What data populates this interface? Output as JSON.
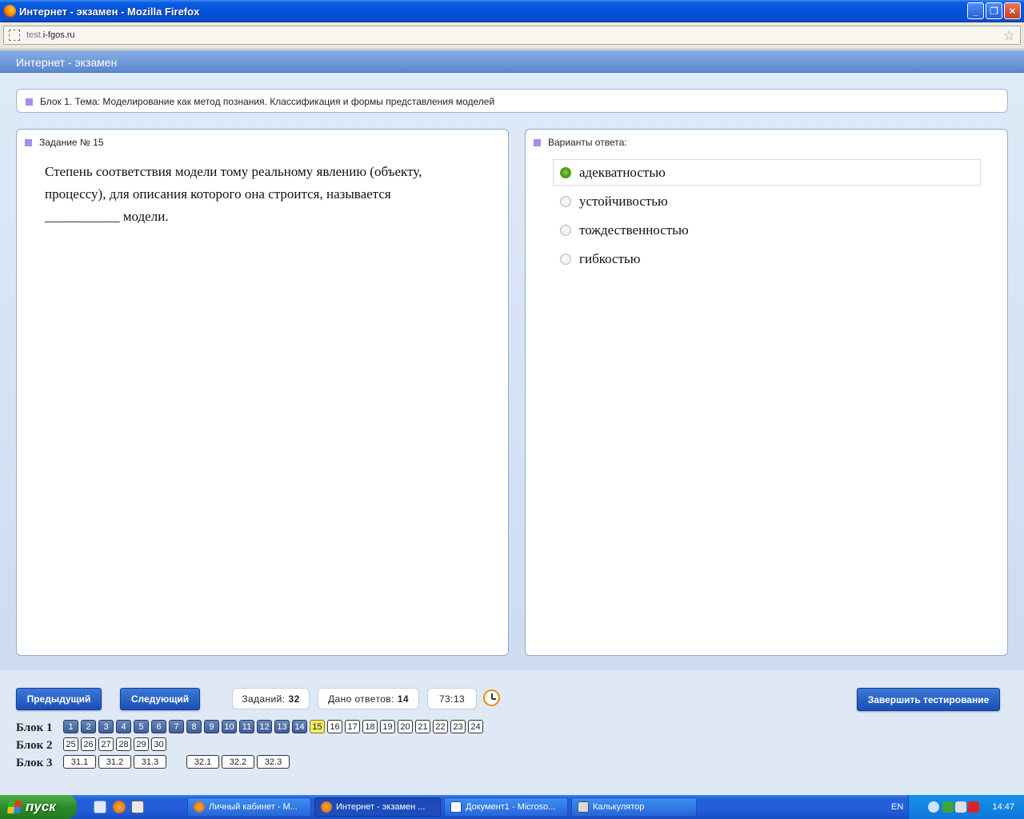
{
  "window": {
    "title": "Интернет - экзамен - Mozilla Firefox",
    "controls": [
      "_",
      "❐",
      "✕"
    ]
  },
  "browser": {
    "url_prefix": "test.",
    "url_host": "i-fgos.ru"
  },
  "app": {
    "header": "Интернет - экзамен"
  },
  "block_title": "Блок 1. Тема: Моделирование как метод познания. Классификация и формы представления моделей",
  "task": {
    "heading": "Задание № 15",
    "question_line1": "Степень соответствия модели тому реальному явлению (объекту,",
    "question_line2": "процессу), для описания которого она строится, называется",
    "question_line3": "___________ модели."
  },
  "answers": {
    "heading": "Варианты ответа:",
    "options": [
      {
        "label": "адекватностью",
        "selected": true
      },
      {
        "label": "устойчивостью",
        "selected": false
      },
      {
        "label": "тождественностью",
        "selected": false
      },
      {
        "label": "гибкостью",
        "selected": false
      }
    ]
  },
  "footer": {
    "prev_label": "Предыдущий",
    "next_label": "Следующий",
    "tasks_label": "Заданий:",
    "tasks_count": "32",
    "answered_label": "Дано ответов:",
    "answered_count": "14",
    "timer": "73:13",
    "finish_label": "Завершить тестирование"
  },
  "navigation": {
    "block1_label": "Блок 1",
    "block2_label": "Блок 2",
    "block3_label": "Блок 3",
    "block1": [
      "1",
      "2",
      "3",
      "4",
      "5",
      "6",
      "7",
      "8",
      "9",
      "10",
      "11",
      "12",
      "13",
      "14",
      "15",
      "16",
      "17",
      "18",
      "19",
      "20",
      "21",
      "22",
      "23",
      "24"
    ],
    "block2": [
      "25",
      "26",
      "27",
      "28",
      "29",
      "30"
    ],
    "block3a": [
      "31.1",
      "31.2",
      "31.3"
    ],
    "block3b": [
      "32.1",
      "32.2",
      "32.3"
    ],
    "answered_count": 14,
    "current": "15"
  },
  "taskbar": {
    "start_label": "пуск",
    "tasks": [
      {
        "label": "Личный кабинет - М...",
        "active": false
      },
      {
        "label": "Интернет - экзамен ...",
        "active": true
      },
      {
        "label": "Документ1 - Microso...",
        "active": false
      },
      {
        "label": "Калькулятор",
        "active": false
      }
    ],
    "lang": "EN",
    "time": "14:47"
  },
  "colors": {
    "accent": "#1a4fb5",
    "answered": "#3f5e98",
    "current": "#f5e866",
    "selected_radio": "#4da018",
    "marker": "#a38ff0"
  }
}
